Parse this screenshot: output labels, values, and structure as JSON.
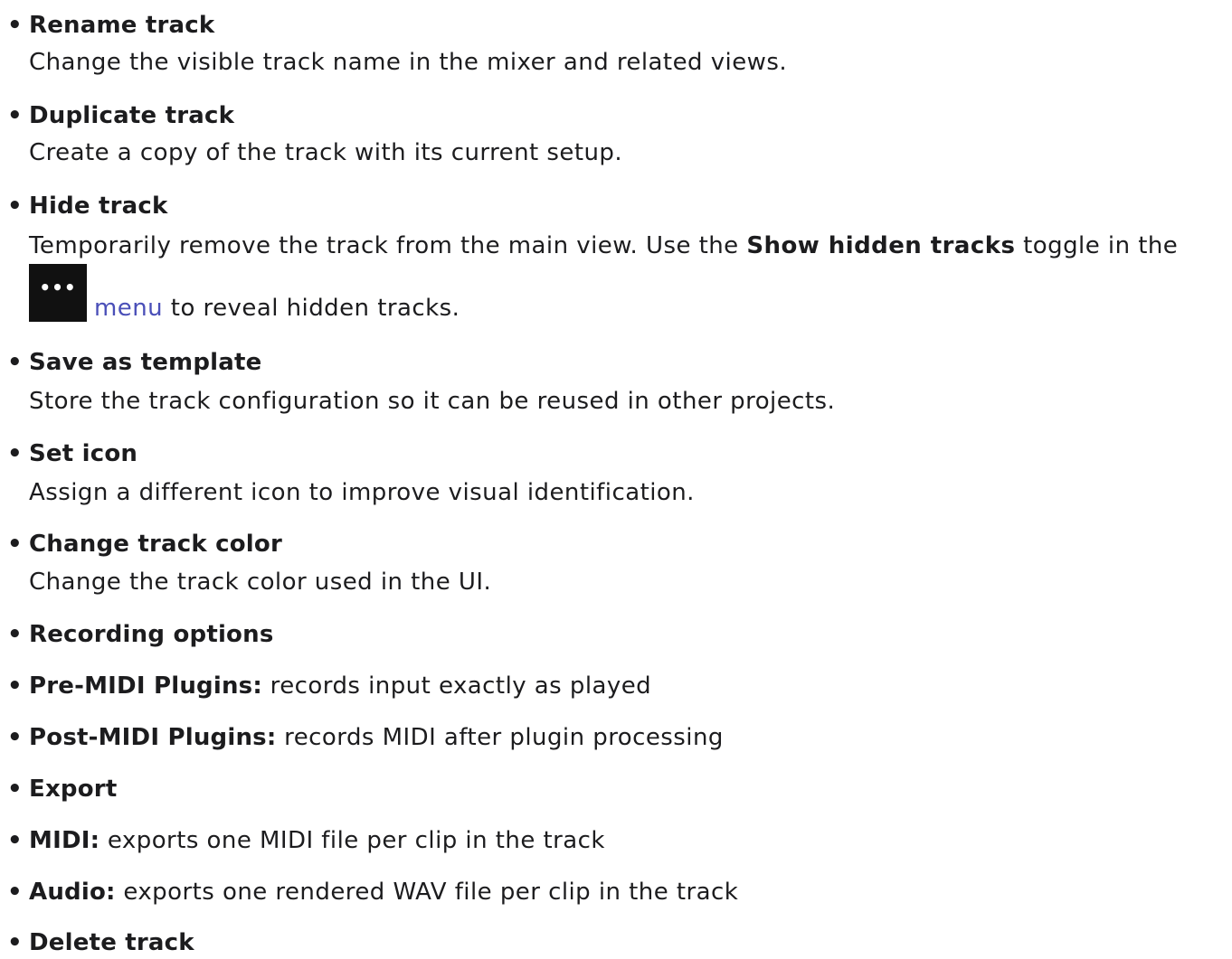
{
  "bullet": "•",
  "items": {
    "rename": {
      "title": "Rename track",
      "desc": "Change the visible track name in the mixer and related views."
    },
    "duplicate": {
      "title": "Duplicate track",
      "desc": "Create a copy of the track with its current setup."
    },
    "hide": {
      "title": "Hide track",
      "desc_part1": "Temporarily remove the track from the main view. Use the ",
      "desc_bold": "Show hidden tracks",
      "desc_part2": " toggle in the",
      "menu_icon_glyph": "•••",
      "menu_icon_name": "more-options-icon",
      "menu_link": "menu",
      "desc_part3": " to reveal hidden tracks."
    },
    "save_template": {
      "title": "Save as template",
      "desc": "Store the track configuration so it can be reused in other projects."
    },
    "set_icon": {
      "title": "Set icon",
      "desc": "Assign a different icon to improve visual identification."
    },
    "change_color": {
      "title": "Change track color",
      "desc": "Change the track color used in the UI."
    },
    "recording": {
      "title": "Recording options"
    },
    "pre_midi": {
      "label": "Pre-MIDI Plugins:",
      "text": " records input exactly as played"
    },
    "post_midi": {
      "label": "Post-MIDI Plugins:",
      "text": " records MIDI after plugin processing"
    },
    "export": {
      "title": "Export"
    },
    "export_midi": {
      "label": "MIDI:",
      "text": " exports one MIDI file per clip in the track"
    },
    "export_audio": {
      "label": "Audio:",
      "text": " exports one rendered WAV file per clip in the track"
    },
    "delete": {
      "title": "Delete track"
    }
  },
  "colors": {
    "text": "#1c1c1e",
    "link": "#4a4fb8",
    "menu_button_bg": "#111111"
  }
}
